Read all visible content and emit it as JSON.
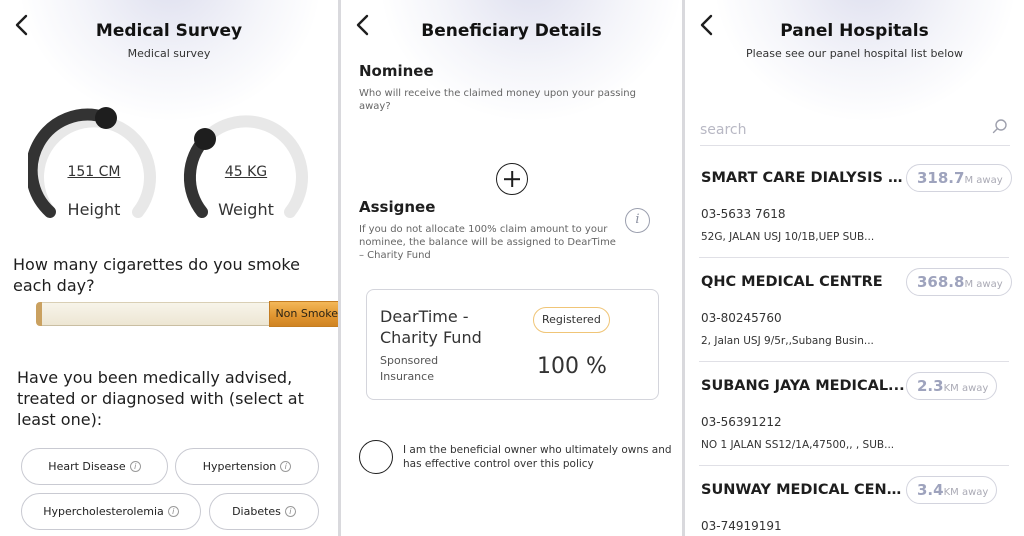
{
  "survey": {
    "title": "Medical Survey",
    "subtitle": "Medical survey",
    "height": {
      "value": "151 CM",
      "label": "Height"
    },
    "weight": {
      "value": "45 KG",
      "label": "Weight"
    },
    "cigarette_question": "How many cigarettes do you smoke each day?",
    "cigarette_value": "Non Smoker",
    "advised_question": "Have you been medically advised, treated or diagnosed with (select at least one):",
    "conditions": [
      "Heart Disease",
      "Hypertension",
      "Hypercholesterolemia",
      "Diabetes"
    ],
    "info_glyph": "i"
  },
  "beneficiary": {
    "title": "Beneficiary Details",
    "nominee_heading": "Nominee",
    "nominee_text": "Who will receive the claimed money upon your passing away?",
    "assignee_heading": "Assignee",
    "assignee_text": "If you do not allocate 100% claim amount to your nominee, the balance will be assigned to DearTime – Charity Fund",
    "info_glyph": "i",
    "card": {
      "name": "DearTime - Charity Fund",
      "status": "Registered",
      "sub": "Sponsored Insurance",
      "percent": "100 %"
    },
    "consent": "I am the beneficial owner who ultimately owns and has effective control over this policy"
  },
  "hospitals": {
    "title": "Panel Hospitals",
    "subtitle": "Please see our panel hospital list below",
    "search_placeholder": "search",
    "items": [
      {
        "name": "SMART CARE DIALYSIS C...",
        "distance": "318.7",
        "unit": "M away",
        "phone": "03-5633 7618",
        "address": "52G, JALAN USJ 10/1B,UEP SUB..."
      },
      {
        "name": "QHC MEDICAL CENTRE",
        "distance": "368.8",
        "unit": "M away",
        "phone": "03-80245760",
        "address": "2, Jalan USJ 9/5r,,Subang Busin..."
      },
      {
        "name": "SUBANG JAYA MEDICAL...",
        "distance": "2.3",
        "unit": "KM away",
        "phone": "03-56391212",
        "address": "NO 1 JALAN SS12/1A,47500,, , SUB..."
      },
      {
        "name": "SUNWAY MEDICAL CENTRE",
        "distance": "3.4",
        "unit": "KM away",
        "phone": "03-74919191",
        "address": ""
      }
    ]
  },
  "icons": {
    "back": "chevron-left-icon",
    "search": "search-icon",
    "info": "info-icon",
    "add": "plus-circle-icon"
  },
  "colors": {
    "gauge_fill": "#333333",
    "gauge_track": "#e8e8e8",
    "filter": "#e49a35",
    "badge_border": "#f0c577",
    "distance_text": "#9ea3bd"
  }
}
